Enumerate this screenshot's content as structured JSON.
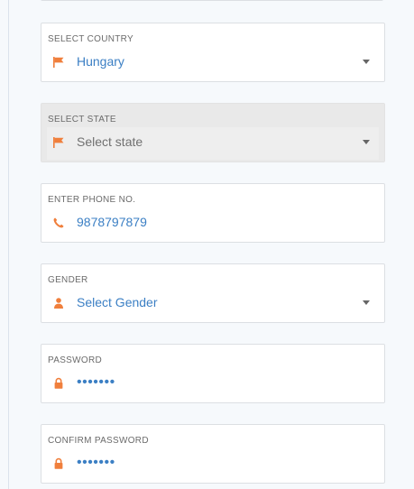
{
  "colors": {
    "accent": "#f07f3c",
    "value_text": "#3b7fc4",
    "border": "#dcdfe3",
    "disabled_bg": "#e9e9e9"
  },
  "fields": {
    "country": {
      "label": "SELECT COUNTRY",
      "value": "Hungary",
      "icon": "flag-icon"
    },
    "state": {
      "label": "SELECT STATE",
      "placeholder": "Select state",
      "icon": "flag-icon",
      "disabled": true
    },
    "phone": {
      "label": "ENTER PHONE NO.",
      "value": "9878797879",
      "icon": "phone-icon"
    },
    "gender": {
      "label": "GENDER",
      "placeholder": "Select Gender",
      "icon": "user-icon"
    },
    "password": {
      "label": "PASSWORD",
      "value": "•••••••",
      "icon": "lock-icon"
    },
    "confirm_password": {
      "label": "CONFIRM PASSWORD",
      "value": "•••••••",
      "icon": "lock-icon"
    }
  }
}
